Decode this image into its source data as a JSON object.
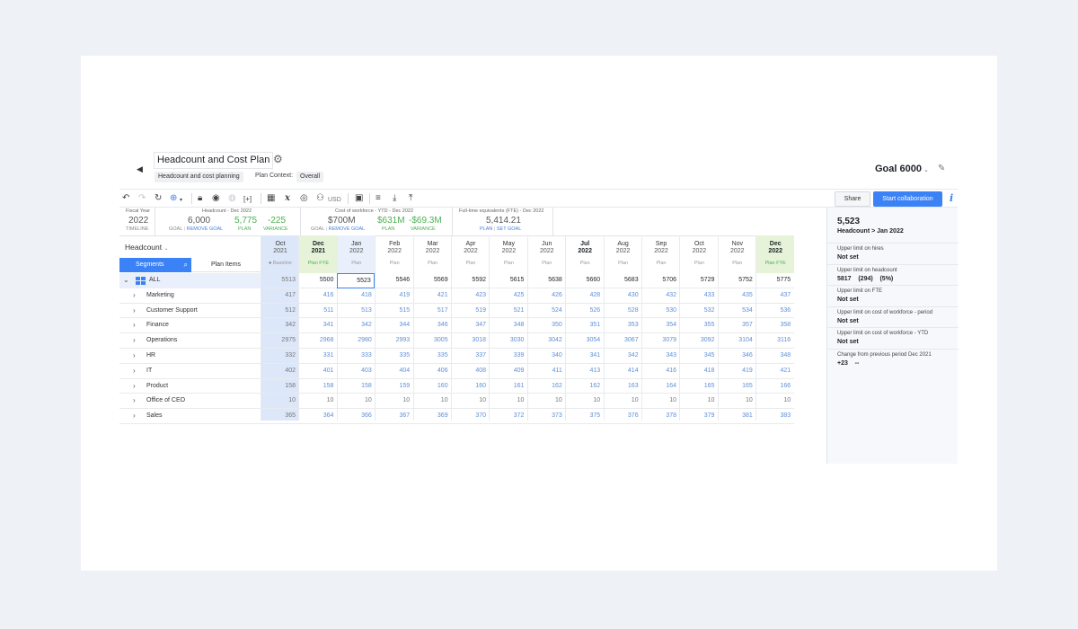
{
  "header": {
    "title": "Headcount and Cost Plan",
    "tag": "Headcount and cost planning",
    "context_label": "Plan Context:",
    "context_value": "Overall",
    "goal": "Goal 6000"
  },
  "toolbar": {
    "currency": "USD",
    "share_label": "Share",
    "collab_label": "Start collaboration"
  },
  "kpis": {
    "fiscal": {
      "label": "Fiscal Year",
      "value": "2022",
      "sub": "TIMELINE"
    },
    "headcount": {
      "label": "Headcount - Dec 2022",
      "goal": "6,000",
      "plan": "5,775",
      "variance": "-225",
      "goal_lbl": "GOAL",
      "remove_goal": "REMOVE GOAL",
      "plan_lbl": "PLAN",
      "variance_lbl": "VARIANCE"
    },
    "cost": {
      "label": "Cost of workforce - YTD - Dec 2022",
      "goal": "$700M",
      "plan": "$631M",
      "variance": "-$69.3M",
      "goal_lbl": "GOAL",
      "remove_goal": "REMOVE GOAL",
      "plan_lbl": "PLAN",
      "variance_lbl": "VARIANCE"
    },
    "fte": {
      "label": "Full-time equivalents (FTE) - Dec 2022",
      "plan": "5,414.21",
      "plan_lbl": "PLAN",
      "set_goal": "SET GOAL"
    }
  },
  "grid": {
    "measure": "Headcount",
    "tab_segments": "Segments",
    "tab_plan_items": "Plan Items",
    "columns": [
      {
        "m": "Oct",
        "y": "2021",
        "s": "Baseline"
      },
      {
        "m": "Dec",
        "y": "2021",
        "s": "Plan FYE"
      },
      {
        "m": "Jan",
        "y": "2022",
        "s": "Plan"
      },
      {
        "m": "Feb",
        "y": "2022",
        "s": "Plan"
      },
      {
        "m": "Mar",
        "y": "2022",
        "s": "Plan"
      },
      {
        "m": "Apr",
        "y": "2022",
        "s": "Plan"
      },
      {
        "m": "May",
        "y": "2022",
        "s": "Plan"
      },
      {
        "m": "Jun",
        "y": "2022",
        "s": "Plan"
      },
      {
        "m": "Jul",
        "y": "2022",
        "s": "Plan"
      },
      {
        "m": "Aug",
        "y": "2022",
        "s": "Plan"
      },
      {
        "m": "Sep",
        "y": "2022",
        "s": "Plan"
      },
      {
        "m": "Oct",
        "y": "2022",
        "s": "Plan"
      },
      {
        "m": "Nov",
        "y": "2022",
        "s": "Plan"
      },
      {
        "m": "Dec",
        "y": "2022",
        "s": "Plan FYE"
      }
    ],
    "rows": [
      {
        "name": "ALL",
        "values": [
          "5513",
          "5500",
          "5523",
          "5546",
          "5569",
          "5592",
          "5615",
          "5638",
          "5660",
          "5683",
          "5706",
          "5729",
          "5752",
          "5775"
        ]
      },
      {
        "name": "Marketing",
        "values": [
          "417",
          "416",
          "418",
          "419",
          "421",
          "423",
          "425",
          "426",
          "428",
          "430",
          "432",
          "433",
          "435",
          "437"
        ]
      },
      {
        "name": "Customer Support",
        "values": [
          "512",
          "511",
          "513",
          "515",
          "517",
          "519",
          "521",
          "524",
          "526",
          "528",
          "530",
          "532",
          "534",
          "536"
        ]
      },
      {
        "name": "Finance",
        "values": [
          "342",
          "341",
          "342",
          "344",
          "346",
          "347",
          "348",
          "350",
          "351",
          "353",
          "354",
          "355",
          "357",
          "358"
        ]
      },
      {
        "name": "Operations",
        "values": [
          "2975",
          "2968",
          "2980",
          "2993",
          "3005",
          "3018",
          "3030",
          "3042",
          "3054",
          "3067",
          "3079",
          "3092",
          "3104",
          "3116"
        ]
      },
      {
        "name": "HR",
        "values": [
          "332",
          "331",
          "333",
          "335",
          "335",
          "337",
          "339",
          "340",
          "341",
          "342",
          "343",
          "345",
          "346",
          "348"
        ]
      },
      {
        "name": "IT",
        "values": [
          "402",
          "401",
          "403",
          "404",
          "406",
          "408",
          "409",
          "411",
          "413",
          "414",
          "416",
          "418",
          "419",
          "421"
        ]
      },
      {
        "name": "Product",
        "values": [
          "158",
          "158",
          "158",
          "159",
          "160",
          "160",
          "161",
          "162",
          "162",
          "163",
          "164",
          "165",
          "165",
          "166"
        ]
      },
      {
        "name": "Office of CEO",
        "values": [
          "10",
          "10",
          "10",
          "10",
          "10",
          "10",
          "10",
          "10",
          "10",
          "10",
          "10",
          "10",
          "10",
          "10"
        ]
      },
      {
        "name": "Sales",
        "values": [
          "365",
          "364",
          "366",
          "367",
          "369",
          "370",
          "372",
          "373",
          "375",
          "376",
          "378",
          "379",
          "381",
          "383"
        ]
      }
    ]
  },
  "panel": {
    "value": "5,523",
    "context": "Headcount > Jan 2022",
    "items": [
      {
        "label": "Upper limit on hires",
        "value": "Not set"
      },
      {
        "label": "Upper limit on headcount",
        "value": "5817    (294)    (5%)"
      },
      {
        "label": "Upper limit on FTE",
        "value": "Not set"
      },
      {
        "label": "Upper limit on cost of workforce - period",
        "value": "Not set"
      },
      {
        "label": "Upper limit on cost of workforce - YTD",
        "value": "Not set"
      },
      {
        "label": "Change from previous period Dec 2021",
        "value": "+23    --"
      }
    ]
  },
  "colors": {
    "accent": "#3b82f6",
    "positive": "#4caf50",
    "highlight_green": "#e7f3d9",
    "highlight_blue": "#dde7fa"
  }
}
